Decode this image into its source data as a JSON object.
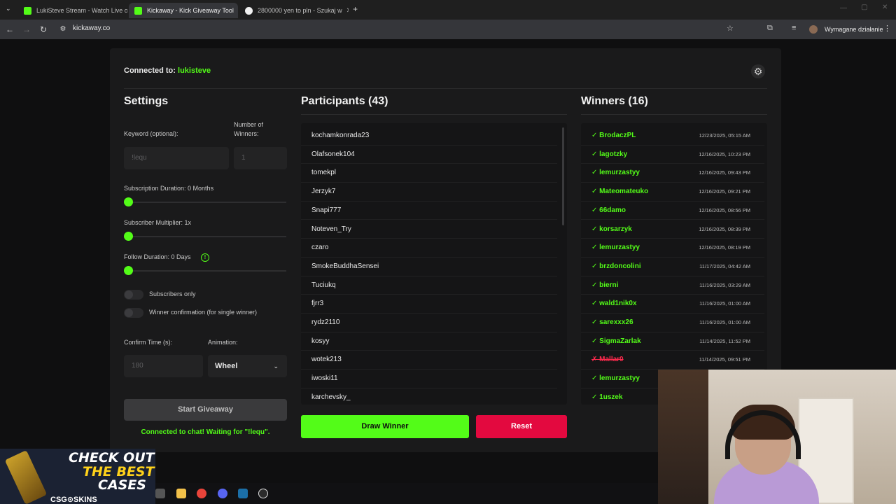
{
  "browser": {
    "tabs": [
      {
        "title": "LukiSteve Stream - Watch Live o",
        "active": false,
        "favicon_color": "#53fc18"
      },
      {
        "title": "Kickaway - Kick Giveaway Tool",
        "active": true,
        "favicon_color": "#53fc18"
      },
      {
        "title": "2800000 yen to pln - Szukaj w",
        "active": false,
        "favicon_color": "#4285f4"
      }
    ],
    "url": "kickaway.co",
    "action_button": "Wymagane działanie"
  },
  "connection": {
    "label": "Connected to:",
    "channel": "lukisteve"
  },
  "settings": {
    "title": "Settings",
    "keyword_label": "Keyword (optional):",
    "keyword_value": "!lequ",
    "winners_label": "Number of Winners:",
    "winners_value": "1",
    "sub_duration_label": "Subscription Duration: 0 Months",
    "sub_multiplier_label": "Subscriber Multiplier: 1x",
    "follow_duration_label": "Follow Duration: 0 Days",
    "subscribers_only_label": "Subscribers only",
    "winner_confirm_label": "Winner confirmation (for single winner)",
    "confirm_time_label": "Confirm Time (s):",
    "confirm_time_value": "180",
    "animation_label": "Animation:",
    "animation_value": "Wheel",
    "start_button": "Start Giveaway",
    "status_text": "Connected to chat! Waiting for \"!lequ\"."
  },
  "participants": {
    "title": "Participants (43)",
    "items": [
      "kochamkonrada23",
      "Olafsonek104",
      "tomekpl",
      "Jerzyk7",
      "Snapi777",
      "Noteven_Try",
      "czaro",
      "SmokeBuddhaSensei",
      "Tuciukq",
      "fjrr3",
      "rydz2110",
      "kosyy",
      "wotek213",
      "iwoski11",
      "karchevsky_"
    ]
  },
  "winners": {
    "title": "Winners (16)",
    "items": [
      {
        "name": "✓ BrodaczPL",
        "date": "12/23/2025, 05:15 AM",
        "valid": true
      },
      {
        "name": "✓ lagotzky",
        "date": "12/16/2025, 10:23 PM",
        "valid": true
      },
      {
        "name": "✓ lemurzastyy",
        "date": "12/16/2025, 09:43 PM",
        "valid": true
      },
      {
        "name": "✓ Mateomateuko",
        "date": "12/16/2025, 09:21 PM",
        "valid": true
      },
      {
        "name": "✓ 66damo",
        "date": "12/16/2025, 08:56 PM",
        "valid": true
      },
      {
        "name": "✓ korsarzyk",
        "date": "12/16/2025, 08:39 PM",
        "valid": true
      },
      {
        "name": "✓ lemurzastyy",
        "date": "12/16/2025, 08:19 PM",
        "valid": true
      },
      {
        "name": "✓ brzdoncolini",
        "date": "11/17/2025, 04:42 AM",
        "valid": true
      },
      {
        "name": "✓ bierni",
        "date": "11/16/2025, 03:29 AM",
        "valid": true
      },
      {
        "name": "✓ wald1nik0x",
        "date": "11/16/2025, 01:00 AM",
        "valid": true
      },
      {
        "name": "✓ sarexxx26",
        "date": "11/16/2025, 01:00 AM",
        "valid": true
      },
      {
        "name": "✓ SigmaZarlak",
        "date": "11/14/2025, 11:52 PM",
        "valid": true
      },
      {
        "name": "✗ Mallar0",
        "date": "11/14/2025, 09:51 PM",
        "valid": false
      },
      {
        "name": "✓ lemurzastyy",
        "date": "",
        "valid": true
      },
      {
        "name": "✓ 1uszek",
        "date": "",
        "valid": true
      }
    ]
  },
  "actions": {
    "draw": "Draw Winner",
    "reset": "Reset"
  },
  "overlay": {
    "promo_line1": "CHECK OUT",
    "promo_line2": "THE BEST",
    "promo_line3": "CASES",
    "promo_brand": "CSG⊙SKINS"
  },
  "colors": {
    "accent": "#53fc18",
    "danger": "#e3093f",
    "background": "#0f0f10",
    "card": "#1a1a1b"
  }
}
